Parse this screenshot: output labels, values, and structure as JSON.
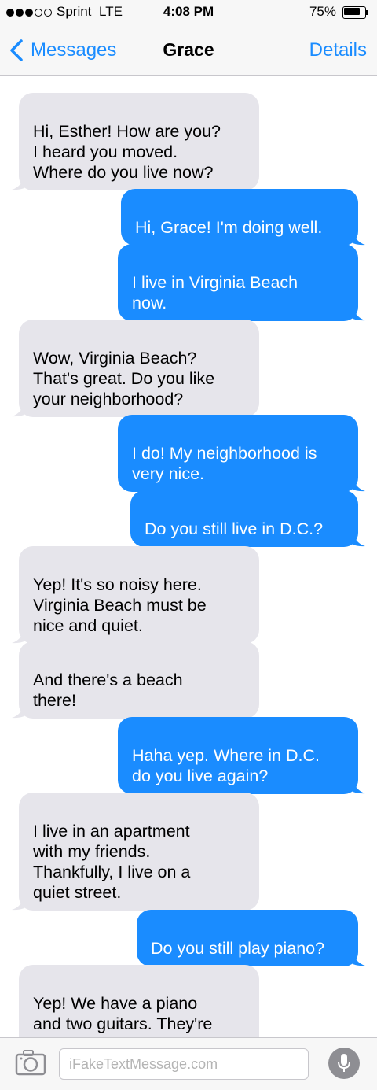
{
  "status_bar": {
    "signal_bars": 3,
    "signal_total": 5,
    "carrier": "Sprint",
    "network": "LTE",
    "time": "4:08 PM",
    "battery_percent": "75%",
    "battery_level": 0.75
  },
  "nav": {
    "back_label": "Messages",
    "title": "Grace",
    "details_label": "Details"
  },
  "messages": [
    {
      "direction": "received",
      "text": "Hi, Esther! How are you?\nI heard you moved.\nWhere do you live now?"
    },
    {
      "direction": "sent",
      "text": "Hi, Grace! I'm doing well."
    },
    {
      "direction": "sent",
      "text": "I live in Virginia Beach\nnow."
    },
    {
      "direction": "received",
      "text": "Wow, Virginia Beach?\nThat's great. Do you like\nyour neighborhood?"
    },
    {
      "direction": "sent",
      "text": "I do! My neighborhood is\nvery nice."
    },
    {
      "direction": "sent",
      "text": "Do you still live in D.C.?"
    },
    {
      "direction": "received",
      "text": "Yep! It's so noisy here.\nVirginia Beach must be\nnice and quiet."
    },
    {
      "direction": "received",
      "text": "And there's a beach\nthere!"
    },
    {
      "direction": "sent",
      "text": "Haha yep. Where in D.C.\ndo you live again?"
    },
    {
      "direction": "received",
      "text": "I live in an apartment\nwith my friends.\nThankfully, I live on a\nquiet street."
    },
    {
      "direction": "sent",
      "text": "Do you still play piano?"
    },
    {
      "direction": "received",
      "text": "Yep! We have a piano\nand two guitars. They're\nmy friends' guitars."
    }
  ],
  "input": {
    "placeholder": "iFakeTextMessage.com",
    "value": ""
  },
  "colors": {
    "sent_bubble": "#1a8cff",
    "received_bubble": "#e6e5eb",
    "accent": "#1a8cff"
  },
  "icons": {
    "back": "chevron-left-icon",
    "camera": "camera-icon",
    "mic": "microphone-icon"
  }
}
